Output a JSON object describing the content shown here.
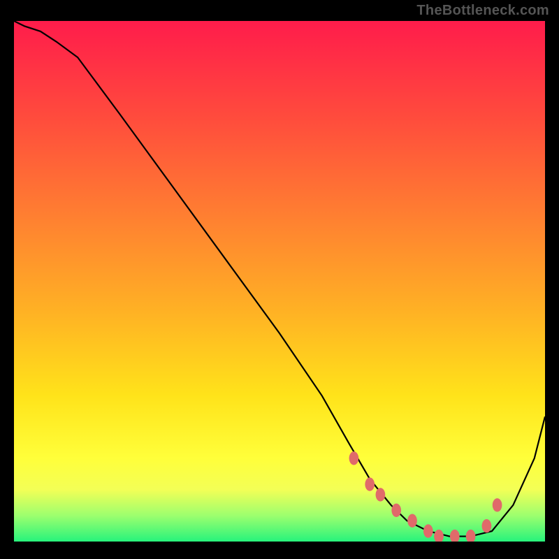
{
  "watermark": "TheBottleneck.com",
  "colors": {
    "background": "#000000",
    "marker": "#e06a6a",
    "line": "#000000"
  },
  "chart_data": {
    "type": "line",
    "title": "",
    "xlabel": "",
    "ylabel": "",
    "xlim": [
      0,
      100
    ],
    "ylim": [
      0,
      100
    ],
    "grid": false,
    "legend": false,
    "gradient_stops": [
      {
        "offset": 0,
        "color": "#ff1c4b"
      },
      {
        "offset": 18,
        "color": "#ff4a3d"
      },
      {
        "offset": 36,
        "color": "#ff7b32"
      },
      {
        "offset": 56,
        "color": "#ffb224"
      },
      {
        "offset": 72,
        "color": "#ffe31a"
      },
      {
        "offset": 84,
        "color": "#ffff3a"
      },
      {
        "offset": 90,
        "color": "#f3ff56"
      },
      {
        "offset": 95,
        "color": "#9dff6e"
      },
      {
        "offset": 100,
        "color": "#27f37c"
      }
    ],
    "series": [
      {
        "name": "bottleneck-curve",
        "x": [
          0,
          2,
          5,
          8,
          12,
          20,
          30,
          40,
          50,
          58,
          63,
          67,
          71,
          74,
          78,
          82,
          86,
          90,
          94,
          98,
          100
        ],
        "y": [
          100,
          99,
          98,
          96,
          93,
          82,
          68,
          54,
          40,
          28,
          19,
          12,
          7,
          4,
          2,
          1,
          1,
          2,
          7,
          16,
          24
        ]
      }
    ],
    "markers": {
      "name": "highlighted-segment",
      "x": [
        64,
        67,
        69,
        72,
        75,
        78,
        80,
        83,
        86,
        89,
        91
      ],
      "y": [
        16,
        11,
        9,
        6,
        4,
        2,
        1,
        1,
        1,
        3,
        7
      ]
    }
  }
}
